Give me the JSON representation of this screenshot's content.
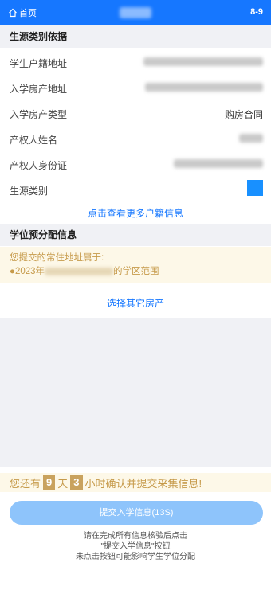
{
  "topbar": {
    "home_label": "首页",
    "right_label": "8-9"
  },
  "section1": {
    "title": "生源类别依据",
    "rows": [
      {
        "label": "学生户籍地址",
        "value": ""
      },
      {
        "label": "入学房产地址",
        "value": ""
      },
      {
        "label": "入学房产类型",
        "value": "购房合同"
      },
      {
        "label": "产权人姓名",
        "value": ""
      },
      {
        "label": "产权人身份证",
        "value": ""
      },
      {
        "label": "生源类别",
        "value": ""
      }
    ],
    "more_link": "点击查看更多户籍信息"
  },
  "section2": {
    "title": "学位预分配信息",
    "notice_line1": "您提交的常住地址属于:",
    "notice_prefix": "●2023年",
    "notice_suffix": "的学区范围",
    "choose_link": "选择其它房产"
  },
  "countdown": {
    "prefix": "您还有",
    "days": "9",
    "day_unit": "天",
    "hours": "3",
    "suffix": "小时确认并提交采集信息!"
  },
  "submit_label": "提交入学信息(13S)",
  "hint": {
    "line1": "请在完成所有信息核验后点击",
    "line2": "\"提交入学信息\"按钮",
    "line3": "未点击按钮可能影响学生学位分配"
  },
  "colors": {
    "primary": "#1677ff",
    "notice_text": "#c69a4a",
    "notice_bg": "#fdf8e8",
    "submit_bg": "#8ec4fb"
  }
}
